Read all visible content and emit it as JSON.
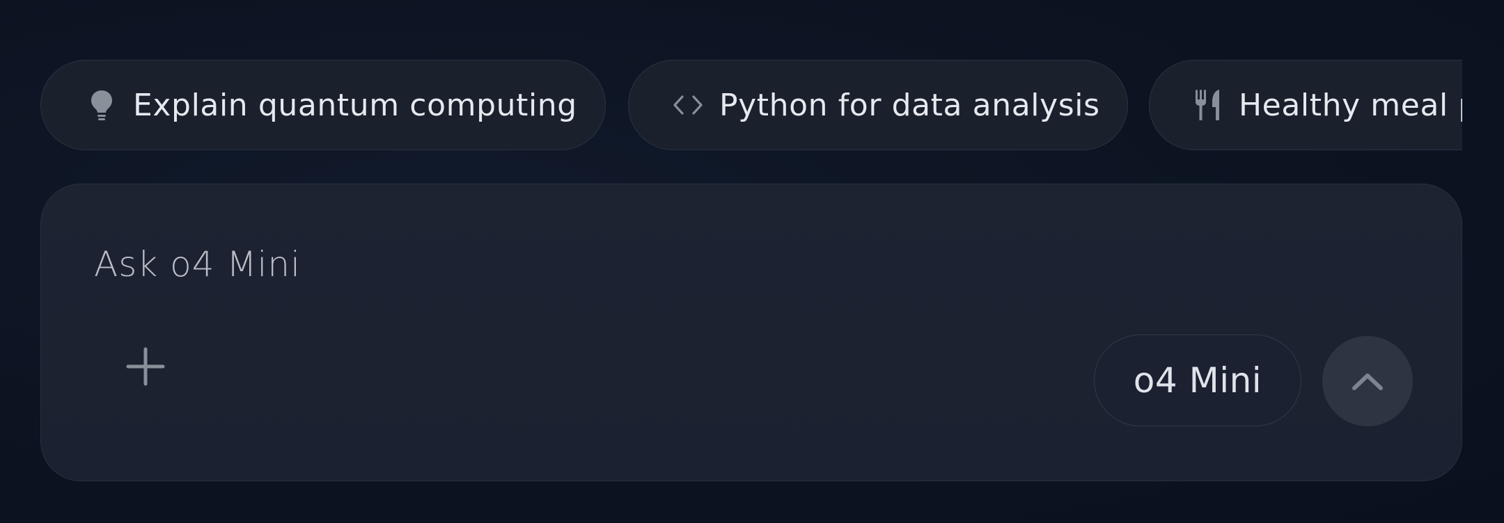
{
  "suggestions": [
    {
      "label": "Explain quantum computing",
      "icon": "lightbulb-icon"
    },
    {
      "label": "Python for data analysis",
      "icon": "code-icon"
    },
    {
      "label": "Healthy meal p",
      "icon": "utensils-icon"
    }
  ],
  "composer": {
    "placeholder": "Ask o4 Mini",
    "add_icon": "plus-icon",
    "model_label": "o4 Mini",
    "send_icon": "chevron-up-icon"
  },
  "colors": {
    "background": "#0c1322",
    "surface": "#1b2130",
    "chip_border": "#2b3342",
    "text_primary": "#e6e9ef",
    "icon_muted": "#858b96",
    "send_button_bg": "#2e3542"
  }
}
